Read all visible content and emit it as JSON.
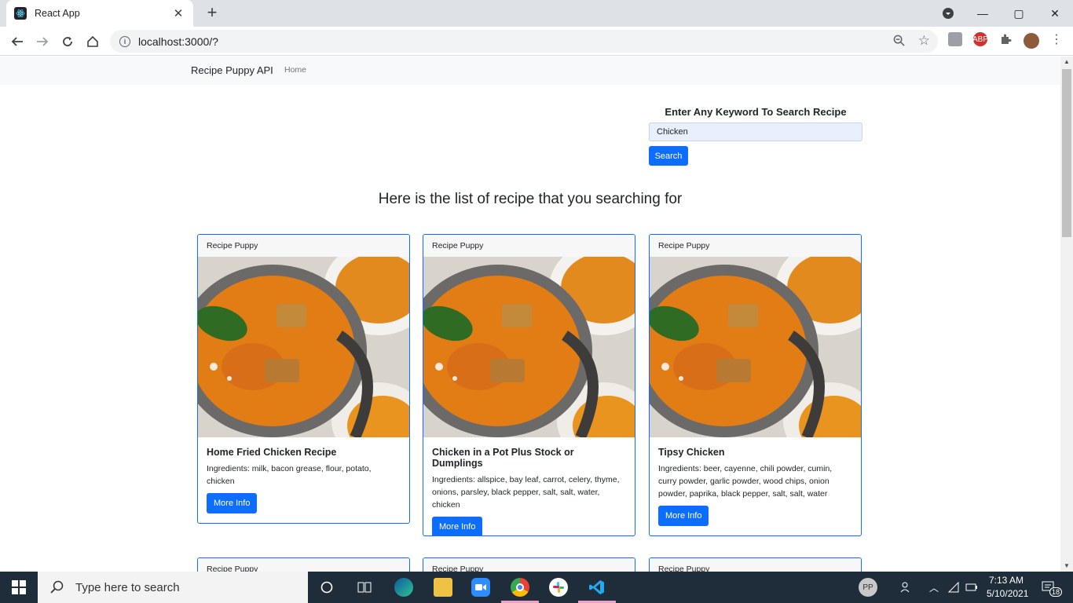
{
  "browser": {
    "tab_title": "React App",
    "tab_close": "✕",
    "new_tab": "+",
    "url": "localhost:3000/?",
    "info_glyph": "i",
    "win_controls": [
      "—",
      "▢",
      "✕"
    ],
    "extensions": [
      {
        "name": "tampermonkey-icon",
        "color": "#9aa0a6"
      },
      {
        "name": "adblock-icon",
        "label": "ABP",
        "color": "#d32f2f"
      },
      {
        "name": "puzzle-icon",
        "color": "#5f6368"
      }
    ]
  },
  "navbar": {
    "brand": "Recipe Puppy API",
    "home": "Home"
  },
  "search": {
    "label": "Enter Any Keyword To Search Recipe",
    "value": "Chicken",
    "button": "Search"
  },
  "main": {
    "heading": "Here is the list of recipe that you searching for",
    "cards": [
      {
        "header": "Recipe Puppy",
        "title": "Home Fried Chicken Recipe",
        "ingredients": "Ingredients: milk, bacon grease, flour, potato, chicken",
        "button": "More Info"
      },
      {
        "header": "Recipe Puppy",
        "title": "Chicken in a Pot Plus Stock or Dumplings",
        "ingredients": "Ingredients: allspice, bay leaf, carrot, celery, thyme, onions, parsley, black pepper, salt, salt, water, chicken",
        "button": "More Info"
      },
      {
        "header": "Recipe Puppy",
        "title": "Tipsy Chicken",
        "ingredients": "Ingredients: beer, cayenne, chili powder, cumin, curry powder, garlic powder, wood chips, onion powder, paprika, black pepper, salt, salt, water",
        "button": "More Info"
      },
      {
        "header": "Recipe Puppy"
      },
      {
        "header": "Recipe Puppy"
      },
      {
        "header": "Recipe Puppy"
      }
    ]
  },
  "taskbar": {
    "search_placeholder": "Type here to search",
    "user_initials": "PP",
    "time": "7:13 AM",
    "date": "5/10/2021",
    "notifications": "18"
  },
  "colors": {
    "primary": "#0d6efd",
    "navbar_bg": "#f8f9fa",
    "taskbar_bg": "#1f2d3a"
  }
}
